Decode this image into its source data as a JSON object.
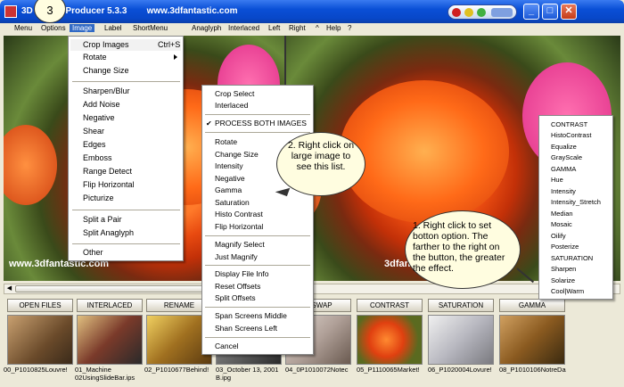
{
  "window": {
    "title": "3D Stereo Producer 5.3.3        www.3dfantastic.com",
    "title_prefix": "3D",
    "step_badge": "3"
  },
  "menubar": {
    "items": [
      "Menu",
      "Options",
      "Image",
      "Label",
      "ShortMenu",
      "Anaglyph",
      "Interlaced",
      "Left",
      "Right",
      "^",
      "Help",
      "?"
    ]
  },
  "image_menu": {
    "items": [
      {
        "label": "Crop Images",
        "shortcut": "Ctrl+S"
      },
      {
        "label": "Rotate"
      },
      {
        "label": "Change Size"
      },
      {
        "label": "Sharpen/Blur"
      },
      {
        "label": "Add Noise"
      },
      {
        "label": "Negative"
      },
      {
        "label": "Shear"
      },
      {
        "label": "Edges"
      },
      {
        "label": "Emboss"
      },
      {
        "label": "Range Detect"
      },
      {
        "label": "Flip Horizontal"
      },
      {
        "label": "Picturize"
      },
      {
        "label": "Split a Pair"
      },
      {
        "label": "Split Anaglyph"
      },
      {
        "label": "Other"
      }
    ]
  },
  "context_menu": {
    "items": [
      "Crop Select",
      "Interlaced",
      "PROCESS BOTH IMAGES",
      "Rotate",
      "Change Size",
      "Intensity",
      "Negative",
      "Gamma",
      "Saturation",
      "Histo Contrast",
      "Flip Horizontal",
      "Magnify Select",
      "Just Magnify",
      "Display File Info",
      "Reset Offsets",
      "Split Offsets",
      "Span Screens Middle",
      "Shan Screens Left",
      "Cancel"
    ],
    "checked": "PROCESS BOTH IMAGES"
  },
  "button_menu": {
    "items": [
      "CONTRAST",
      "HistoContrast",
      "Equalize",
      "GrayScale",
      "GAMMA",
      "Hue",
      "Intensity",
      "Intensity_Stretch",
      "Median",
      "Mosaic",
      "Oilify",
      "Posterize",
      "SATURATION",
      "Sharpen",
      "Solarize",
      "Cool|Warm"
    ]
  },
  "callouts": {
    "two": "2. Right click on large image to see this list.",
    "one": "1. Right click to set botton option. The farther to the right on the button, the greater the effect."
  },
  "watermarks": {
    "left": "www.3dfantastic.com",
    "right": "3dfantastic.com"
  },
  "buttons": [
    "OPEN FILES",
    "INTERLACED",
    "RENAME",
    "",
    "R/SWAP",
    "CONTRAST",
    "SATURATION",
    "GAMMA"
  ],
  "thumbnails": [
    {
      "caption": "00_P1010825Louvre!",
      "caption2": ""
    },
    {
      "caption": "01_Machine",
      "caption2": "02UsingSlideBar.ips"
    },
    {
      "caption": "02_P1010677Behind!",
      "caption2": ""
    },
    {
      "caption": "03_October 13, 2001",
      "caption2": "B.ipg"
    },
    {
      "caption": "04_0P1010072Notec",
      "caption2": ""
    },
    {
      "caption": "05_P1110065Market!",
      "caption2": ""
    },
    {
      "caption": "06_P1020004Lovure!",
      "caption2": ""
    },
    {
      "caption": "08_P1010106NotreDa",
      "caption2": ""
    }
  ],
  "colors": {
    "titlebar": "#0a4fd6",
    "menu_highlight": "#316ac5",
    "balloon": "#fffde0"
  }
}
